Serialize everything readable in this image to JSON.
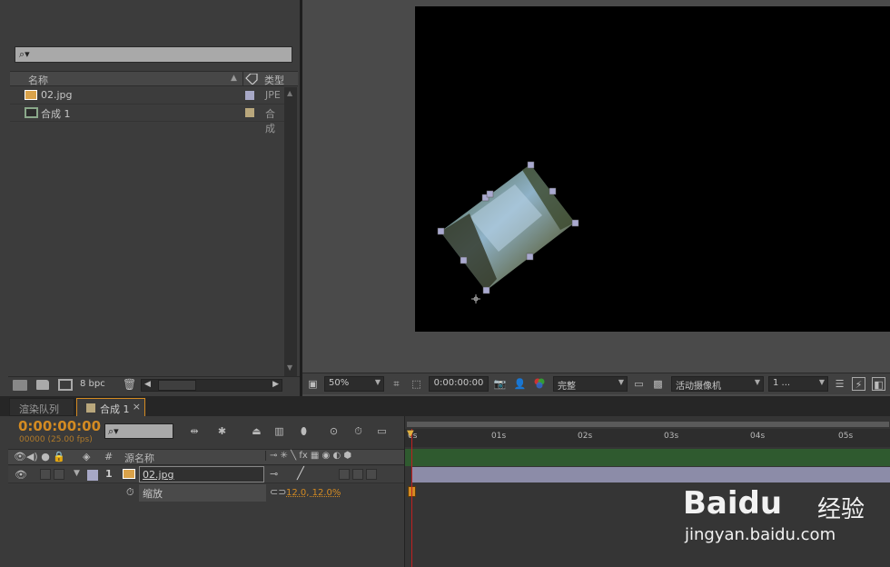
{
  "project": {
    "search_placeholder": "⌕▾",
    "columns": {
      "name": "名称",
      "type": "类型"
    },
    "items": [
      {
        "name": "02.jpg",
        "type": "JPE",
        "label_color": "#a7a8c6"
      },
      {
        "name": "合成  1",
        "type": "合成",
        "label_color": "#b9a77c"
      }
    ],
    "bpc": "8 bpc"
  },
  "viewer": {
    "zoom": "50%",
    "timecode": "0:00:00:00",
    "resolution": "完整",
    "camera": "活动摄像机",
    "views": "1 ..."
  },
  "tabs": [
    {
      "label": "渲染队列",
      "active": false
    },
    {
      "label": "合成  1",
      "active": true,
      "close": "×"
    }
  ],
  "timeline": {
    "current_time": "0:00:00:00",
    "frame_info": "00000 (25.00 fps)",
    "search_placeholder": "⌕▾",
    "col_num": "#",
    "col_source": "源名称",
    "ruler": [
      "0s",
      "01s",
      "02s",
      "03s",
      "04s",
      "05s"
    ],
    "layer": {
      "index": "1",
      "name": "02.jpg",
      "label_color": "#a7a8c6"
    },
    "property": {
      "name": "缩放",
      "value": "12.0, 12.0%"
    }
  },
  "watermark": {
    "brand": "Baidu",
    "brand_cn": "经验",
    "url": "jingyan.baidu.com"
  },
  "colors": {
    "accent_orange": "#d48b22",
    "layer_bar": "#8c8ca8",
    "playhead": "#c02020"
  }
}
